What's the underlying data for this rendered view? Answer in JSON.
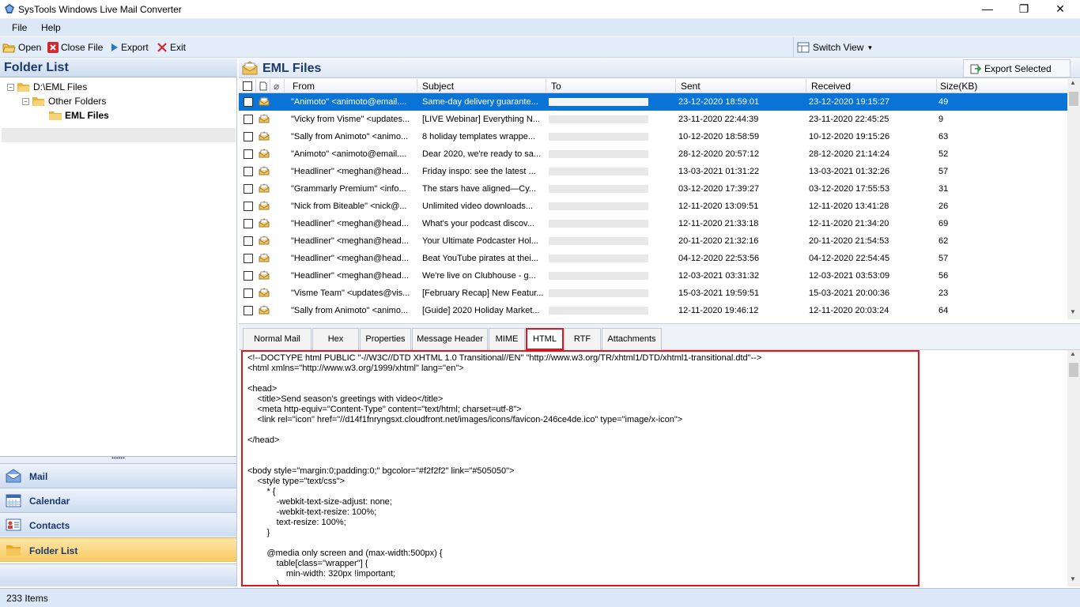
{
  "window": {
    "title": "SysTools Windows Live Mail Converter",
    "minimize": "—",
    "maximize": "❐",
    "close": "✕"
  },
  "menu": {
    "file": "File",
    "help": "Help"
  },
  "toolbar": {
    "open": "Open",
    "close_file": "Close File",
    "export": "Export",
    "exit": "Exit",
    "switch_view": "Switch View"
  },
  "left": {
    "header": "Folder List",
    "tree": {
      "root": "D:\\EML Files",
      "child": "Other Folders",
      "leaf": "EML Files"
    },
    "splitter": "••••••",
    "nav": {
      "mail": "Mail",
      "calendar": "Calendar",
      "contacts": "Contacts",
      "folder_list": "Folder List"
    }
  },
  "main": {
    "title": "EML Files",
    "export_selected": "Export Selected",
    "columns": {
      "from": "From",
      "subject": "Subject",
      "to": "To",
      "sent": "Sent",
      "received": "Received",
      "size": "Size(KB)"
    },
    "rows": [
      {
        "from": "\"Animoto\" <animoto@email....",
        "subject": "Same-day delivery guarante...",
        "sent": "23-12-2020 18:59:01",
        "received": "23-12-2020 19:15:27",
        "size": "49"
      },
      {
        "from": "\"Vicky from Visme\" <updates...",
        "subject": "[LIVE Webinar] Everything N...",
        "sent": "23-11-2020 22:44:39",
        "received": "23-11-2020 22:45:25",
        "size": "9"
      },
      {
        "from": "\"Sally from Animoto\" <animo...",
        "subject": "8 holiday templates wrappe...",
        "sent": "10-12-2020 18:58:59",
        "received": "10-12-2020 19:15:26",
        "size": "63"
      },
      {
        "from": "\"Animoto\" <animoto@email....",
        "subject": "Dear 2020, we're ready to sa...",
        "sent": "28-12-2020 20:57:12",
        "received": "28-12-2020 21:14:24",
        "size": "52"
      },
      {
        "from": "\"Headliner\" <meghan@head...",
        "subject": "Friday inspo: see the latest ...",
        "sent": "13-03-2021 01:31:22",
        "received": "13-03-2021 01:32:26",
        "size": "57"
      },
      {
        "from": "\"Grammarly Premium\" <info...",
        "subject": "The stars have aligned—Cy...",
        "sent": "03-12-2020 17:39:27",
        "received": "03-12-2020 17:55:53",
        "size": "31"
      },
      {
        "from": "\"Nick from Biteable\" <nick@...",
        "subject": "Unlimited video downloads...",
        "sent": "12-11-2020 13:09:51",
        "received": "12-11-2020 13:41:28",
        "size": "26"
      },
      {
        "from": "\"Headliner\" <meghan@head...",
        "subject": "What's your podcast discov...",
        "sent": "12-11-2020 21:33:18",
        "received": "12-11-2020 21:34:20",
        "size": "69"
      },
      {
        "from": "\"Headliner\" <meghan@head...",
        "subject": "Your Ultimate Podcaster Hol...",
        "sent": "20-11-2020 21:32:16",
        "received": "20-11-2020 21:54:53",
        "size": "62"
      },
      {
        "from": "\"Headliner\" <meghan@head...",
        "subject": "Beat YouTube pirates at thei...",
        "sent": "04-12-2020 22:53:56",
        "received": "04-12-2020 22:54:45",
        "size": "57"
      },
      {
        "from": "\"Headliner\" <meghan@head...",
        "subject": "We're live on Clubhouse - g...",
        "sent": "12-03-2021 03:31:32",
        "received": "12-03-2021 03:53:09",
        "size": "56"
      },
      {
        "from": "\"Visme Team\" <updates@vis...",
        "subject": "[February Recap] New Featur...",
        "sent": "15-03-2021 19:59:51",
        "received": "15-03-2021 20:00:36",
        "size": "23"
      },
      {
        "from": "\"Sally from Animoto\" <animo...",
        "subject": "[Guide] 2020 Holiday Market...",
        "sent": "12-11-2020 19:46:12",
        "received": "12-11-2020 20:03:24",
        "size": "64"
      }
    ],
    "tabs": [
      "Normal Mail View",
      "Hex",
      "Properties",
      "Message Header",
      "MIME",
      "HTML",
      "RTF",
      "Attachments"
    ],
    "code_lines": [
      "<!--DOCTYPE html PUBLIC \"-//W3C//DTD XHTML 1.0 Transitional//EN\" \"http://www.w3.org/TR/xhtml1/DTD/xhtml1-transitional.dtd\"-->",
      "<html xmlns=\"http://www.w3.org/1999/xhtml\" lang=\"en\">",
      "",
      "<head>",
      "    <title>Send season's greetings with video</title>",
      "    <meta http-equiv=\"Content-Type\" content=\"text/html; charset=utf-8\">",
      "    <link rel=\"icon\" href=\"//d14f1fnryngsxt.cloudfront.net/images/icons/favicon-246ce4de.ico\" type=\"image/x-icon\">",
      "",
      "</head>",
      "",
      "",
      "<body style=\"margin:0;padding:0;\" bgcolor=\"#f2f2f2\" link=\"#505050\">",
      "    <style type=\"text/css\">",
      "        * {",
      "            -webkit-text-size-adjust: none;",
      "            -webkit-text-resize: 100%;",
      "            text-resize: 100%;",
      "        }",
      "",
      "        @media only screen and (max-width:500px) {",
      "            table[class=\"wrapper\"] {",
      "                min-width: 320px !important;",
      "            }"
    ]
  },
  "status": {
    "items": "233 Items"
  },
  "colors": {
    "selection": "#0a74d6",
    "highlight_border": "#e0161f",
    "active_nav": "#f8c860"
  }
}
